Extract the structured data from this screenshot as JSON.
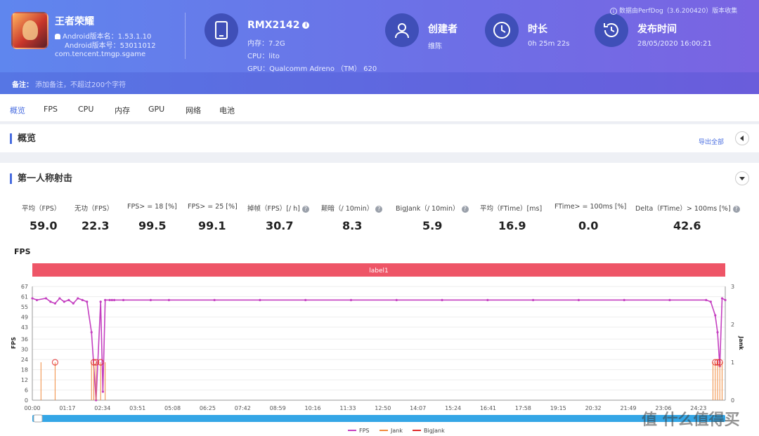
{
  "app": {
    "name": "王者荣耀",
    "version_name": "Android版本名：1.53.1.10",
    "version_code": "Android版本号：53011012",
    "package": "com.tencent.tmgp.sgame"
  },
  "device": {
    "model": "RMX2142",
    "memory": "内存：7.2G",
    "cpu": "CPU：lito",
    "gpu": "GPU：Qualcomm Adreno （TM） 620"
  },
  "creator": {
    "label": "创建者",
    "value": "维陈"
  },
  "duration": {
    "label": "时长",
    "value": "0h 25m 22s"
  },
  "publish": {
    "label": "发布时间",
    "value": "28/05/2020 16:00:21"
  },
  "source": "数据由PerfDog（3.6.200420）版本收集",
  "note": {
    "label": "备注：",
    "placeholder": "添加备注，不超过200个字符"
  },
  "tabs": [
    "概览",
    "FPS",
    "CPU",
    "内存",
    "GPU",
    "网络",
    "电池"
  ],
  "overview": {
    "title": "概览",
    "export": "导出全部"
  },
  "section": {
    "title": "第一人称射击"
  },
  "metrics": [
    {
      "label": "平均（FPS）",
      "value": "59.0",
      "help": false
    },
    {
      "label": "无功（FPS）",
      "value": "22.3",
      "help": false
    },
    {
      "label": "FPS> = 18 [%]",
      "value": "99.5",
      "help": false
    },
    {
      "label": "FPS> = 25 [%]",
      "value": "99.1",
      "help": false
    },
    {
      "label": "掉帧（FPS）[/ h]",
      "value": "30.7",
      "help": true
    },
    {
      "label": "颠暗（/ 10min）",
      "value": "8.3",
      "help": true
    },
    {
      "label": "BigJank（/ 10min）",
      "value": "5.9",
      "help": true
    },
    {
      "label": "平均（FTime）[ms]",
      "value": "16.9",
      "help": false
    },
    {
      "label": "FTime> = 100ms [%]",
      "value": "0.0",
      "help": false
    },
    {
      "label": "Delta（FTime）> 100ms [%]",
      "value": "42.6",
      "help": true
    }
  ],
  "watermark": "值 什么值得买",
  "colors": {
    "accent": "#4a6ee0",
    "fps": "#c43fc0",
    "jank": "#f08a3c",
    "bigjank": "#e02b2b",
    "label_bar": "#ee5567",
    "scroll": "#34a6e6"
  },
  "chart_data": {
    "type": "line",
    "title": "FPS",
    "label_bar": "label1",
    "ylabel": "FPS",
    "y2label": "Jank",
    "ylim": [
      0,
      67
    ],
    "y2lim": [
      0,
      3
    ],
    "yticks": [
      0,
      6,
      12,
      18,
      24,
      30,
      36,
      43,
      49,
      55,
      61,
      67
    ],
    "y2ticks": [
      0,
      1,
      2,
      3
    ],
    "xlim_seconds": [
      0,
      1522
    ],
    "xticks": [
      "00:00",
      "01:17",
      "02:34",
      "03:51",
      "05:08",
      "06:25",
      "07:42",
      "08:59",
      "10:16",
      "11:33",
      "12:50",
      "14:07",
      "15:24",
      "16:41",
      "17:58",
      "19:15",
      "20:32",
      "21:49",
      "23:06",
      "24:23"
    ],
    "series": [
      {
        "name": "FPS",
        "axis": "left",
        "x_seconds": [
          0,
          10,
          30,
          40,
          50,
          60,
          70,
          80,
          90,
          100,
          110,
          120,
          130,
          140,
          150,
          155,
          160,
          170,
          175,
          180,
          200,
          260,
          300,
          400,
          500,
          600,
          700,
          800,
          900,
          1000,
          1100,
          1200,
          1300,
          1400,
          1480,
          1490,
          1500,
          1505,
          1510,
          1515,
          1522
        ],
        "values": [
          60,
          59,
          60,
          58,
          57,
          60,
          58,
          59,
          57,
          60,
          59,
          58,
          40,
          0,
          58,
          5,
          59,
          59,
          59,
          59,
          59,
          59,
          59,
          59,
          59,
          59,
          59,
          59,
          59,
          59,
          59,
          59,
          59,
          59,
          59,
          58,
          50,
          40,
          20,
          60,
          59
        ]
      },
      {
        "name": "Jank",
        "axis": "right",
        "x_seconds": [
          19,
          50,
          130,
          135,
          140,
          150,
          160,
          1495,
          1500,
          1505,
          1510,
          1515
        ],
        "values": [
          1,
          1,
          1,
          1,
          1,
          1,
          1,
          1,
          1,
          1,
          1,
          1
        ]
      },
      {
        "name": "BigJank",
        "axis": "right",
        "x_seconds": [
          50,
          135,
          140,
          150,
          1500,
          1505,
          1510
        ],
        "values": [
          1,
          1,
          1,
          1,
          1,
          1,
          1
        ]
      }
    ],
    "legend": "bottom"
  }
}
